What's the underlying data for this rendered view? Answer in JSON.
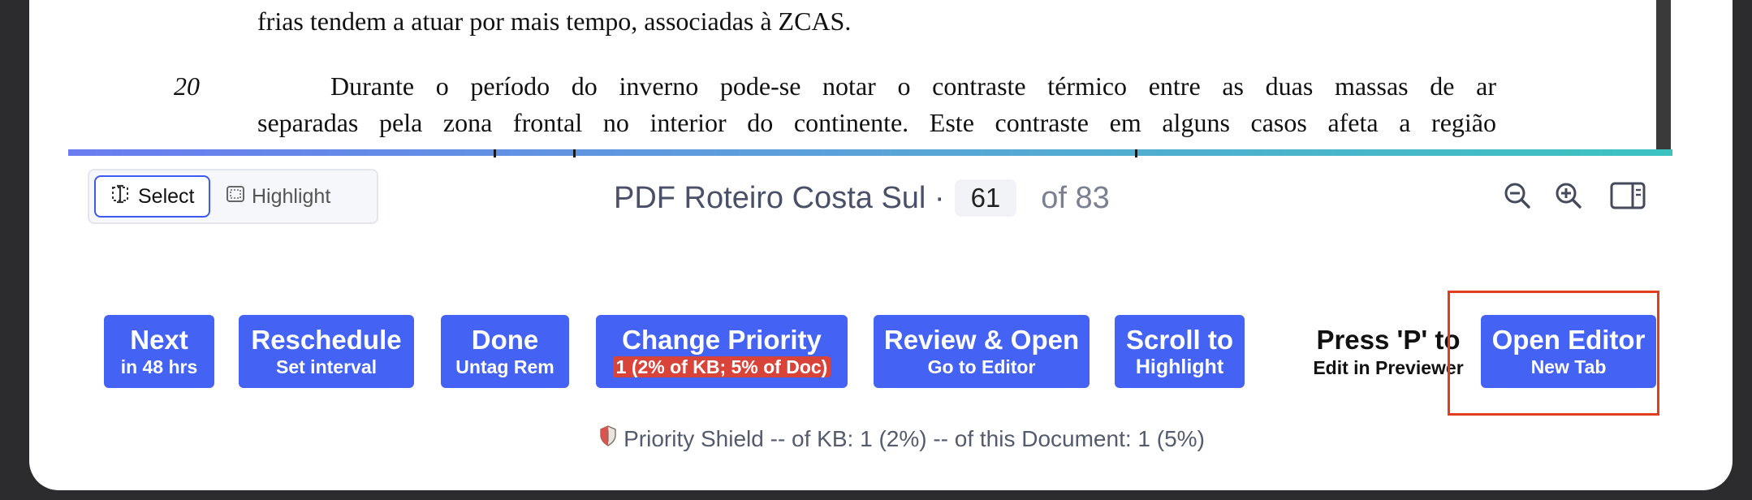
{
  "document": {
    "line_a": "frias tendem a atuar por mais tempo, associadas à ZCAS.",
    "line_number": "20",
    "line_b": "Durante o período do inverno pode-se notar o contraste térmico entre as duas massas de ar",
    "line_c": "separadas pela zona frontal no interior do continente. Este contraste em alguns casos afeta a região"
  },
  "toolbar": {
    "select_label": "Select",
    "highlight_label": "Highlight",
    "doc_title": "PDF Roteiro Costa Sul ·",
    "page_current": "61",
    "page_total": "of 83"
  },
  "actions": {
    "next": {
      "main": "Next",
      "sub": "in 48 hrs"
    },
    "reschedule": {
      "main": "Reschedule",
      "sub": "Set interval"
    },
    "done": {
      "main": "Done",
      "sub": "Untag Rem"
    },
    "change_priority": {
      "main": "Change Priority",
      "sub": "1 (2% of KB; 5% of Doc)"
    },
    "review_open": {
      "main": "Review & Open",
      "sub": "Go to Editor"
    },
    "scroll_to": {
      "main": "Scroll to",
      "sub": "Highlight"
    },
    "press_p": {
      "main": "Press 'P' to",
      "sub": "Edit in Previewer"
    },
    "open_editor": {
      "main": "Open Editor",
      "sub": "New Tab"
    }
  },
  "footer": {
    "priority_shield": "Priority Shield -- of KB: 1 (2%) -- of this Document: 1 (5%)"
  },
  "colors": {
    "button_blue": "#4463f5",
    "priority_red": "#d9443a",
    "focus_outline": "#e03e1f"
  },
  "icons": [
    "text-select-icon",
    "highlight-area-icon",
    "zoom-out-icon",
    "zoom-in-icon",
    "sidebar-toggle-icon",
    "shield-icon"
  ]
}
